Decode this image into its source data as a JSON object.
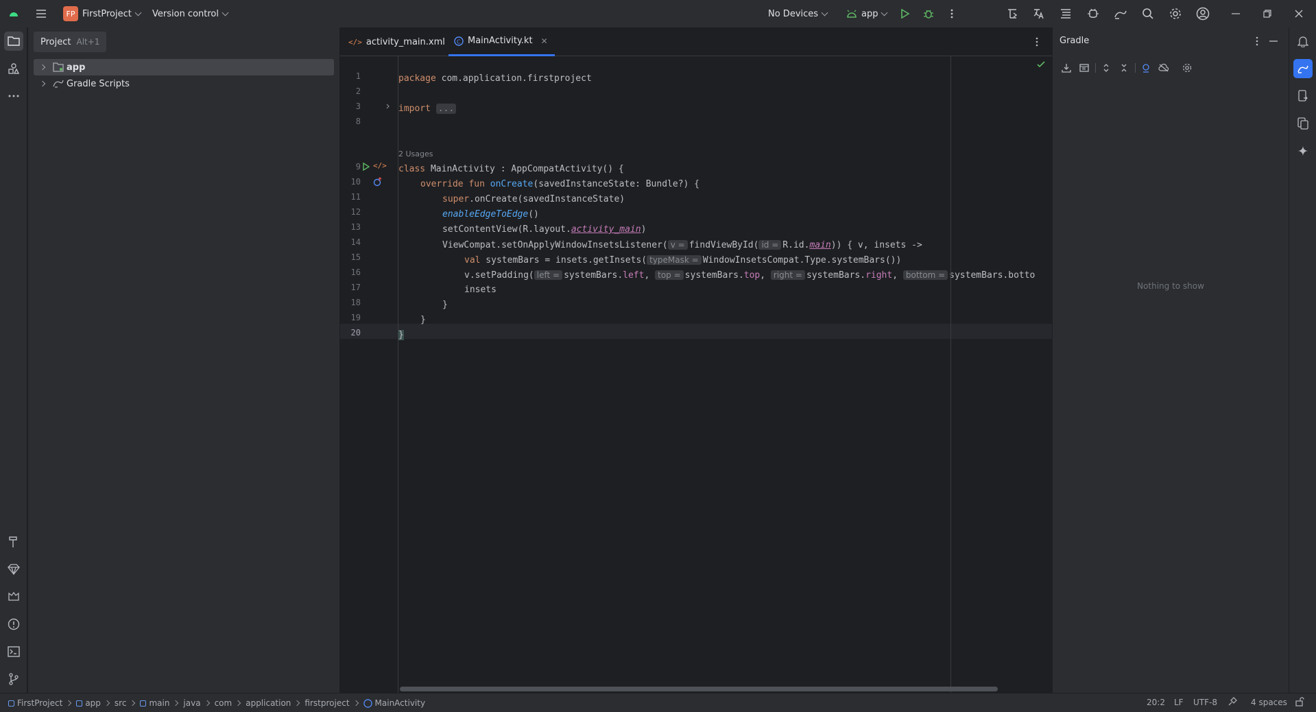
{
  "titlebar": {
    "project_badge": "FP",
    "project_name": "FirstProject",
    "vcs_label": "Version control",
    "devices_label": "No Devices",
    "run_config": "app"
  },
  "project_panel": {
    "tab_label": "Project",
    "tab_shortcut": "Alt+1",
    "tree": [
      {
        "label": "app",
        "selected": true
      },
      {
        "label": "Gradle Scripts",
        "selected": false
      }
    ]
  },
  "editor": {
    "tabs": [
      {
        "label": "activity_main.xml",
        "active": false
      },
      {
        "label": "MainActivity.kt",
        "active": true
      }
    ],
    "line_numbers": [
      "1",
      "2",
      "3",
      "8",
      "",
      "9",
      "10",
      "11",
      "12",
      "13",
      "14",
      "15",
      "16",
      "17",
      "18",
      "19",
      "20"
    ],
    "usages_label": "2 Usages",
    "code": {
      "l1_kw": "package",
      "l1_rest": " com.application.firstproject",
      "l3_kw": "import",
      "l3_fold": "...",
      "l9_kw": "class",
      "l9_rest": " MainActivity : AppCompatActivity() {",
      "l10_kw": "override fun",
      "l10_fn": "onCreate",
      "l10_rest": "(savedInstanceState: Bundle?) {",
      "l11_kw": "super",
      "l11_rest": ".onCreate(savedInstanceState)",
      "l12_it": "enableEdgeToEdge",
      "l12_rest": "()",
      "l13_a": "setContentView(R.layout.",
      "l13_p": "activity_main",
      "l13_b": ")",
      "l14_a": "ViewCompat.setOnApplyWindowInsetsListener(",
      "l14_h1": "v =",
      "l14_b": "findViewById(",
      "l14_h2": "id =",
      "l14_c": "R.id.",
      "l14_p": "main",
      "l14_d": ")) { v, insets ->",
      "l15_kw": "val",
      "l15_a": " systemBars = insets.getInsets(",
      "l15_h": "typeMask =",
      "l15_b": "WindowInsetsCompat.Type.systemBars())",
      "l16_a": "v.setPadding(",
      "l16_h1": "left =",
      "l16_b": "systemBars.",
      "l16_p1": "left",
      "l16_c": ",",
      "l16_h2": "top =",
      "l16_d": "systemBars.",
      "l16_p2": "top",
      "l16_e": ",",
      "l16_h3": "right =",
      "l16_f": "systemBars.",
      "l16_p3": "right",
      "l16_g": ",",
      "l16_h4": "bottom =",
      "l16_i": "systemBars.botto",
      "l17": "insets",
      "l18": "}",
      "l19": "}",
      "l20": "}"
    }
  },
  "gradle_panel": {
    "title": "Gradle",
    "empty_text": "Nothing to show"
  },
  "statusbar": {
    "breadcrumbs": [
      "FirstProject",
      "app",
      "src",
      "main",
      "java",
      "com",
      "application",
      "firstproject",
      "MainActivity"
    ],
    "cursor": "20:2",
    "line_sep": "LF",
    "encoding": "UTF-8",
    "indent": "4 spaces"
  },
  "colors": {
    "accent": "#3574f0",
    "keyword": "#cf8e6d",
    "function": "#56a8f5",
    "property": "#c77dbb",
    "run_green": "#5fb865"
  }
}
